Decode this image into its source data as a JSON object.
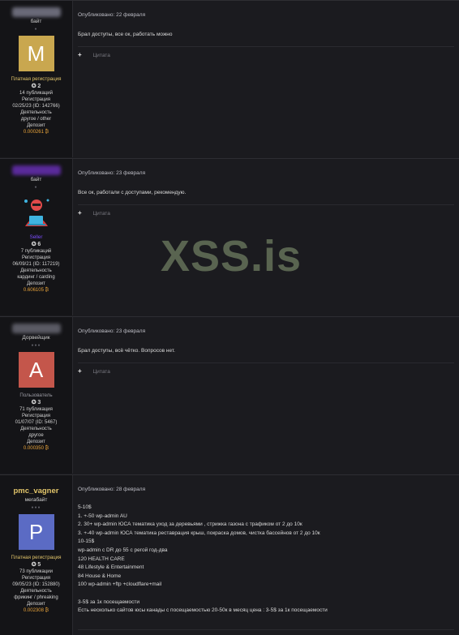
{
  "watermark": "XSS.is",
  "quote_label": "Цитата",
  "plus_glyph": "+",
  "posts": [
    {
      "rank": "байт",
      "dots": "●",
      "avatar_letter": "M",
      "avatar_color": "#c9a74f",
      "role": "Платная регистрация",
      "role_color": "#e2c56a",
      "reactions": "2",
      "publications": "14 публикаций",
      "reg_label": "Регистрация",
      "reg_value": "02/25/23 (ID: 142766)",
      "activity_label": "Деятельность",
      "activity_value": "другое / other",
      "deposit_label": "Депозит",
      "deposit_value": "0.000261 ₿",
      "posted": "Опубликовано: 22 февраля",
      "text": "Брал доступы, все ок, работать можно"
    },
    {
      "rank": "байт",
      "dots": "●",
      "avatar_letter": "",
      "avatar_color": "#141417",
      "role": "Seller",
      "role_color": "#7c4dff",
      "reactions": "6",
      "publications": "7 публикаций",
      "reg_label": "Регистрация",
      "reg_value": "06/09/21 (ID: 117219)",
      "activity_label": "Деятельность",
      "activity_value": "кардинг / carding",
      "deposit_label": "Депозит",
      "deposit_value": "0.606105 ₿",
      "posted": "Опубликовано: 23 февраля",
      "text": "Все ок, работали с доступами, рекомендую."
    },
    {
      "rank": "Дорвейщик",
      "dots": "●●●",
      "avatar_letter": "A",
      "avatar_color": "#c4564b",
      "role": "Пользователь",
      "role_color": "#9a9aa2",
      "reactions": "3",
      "publications": "71 публикация",
      "reg_label": "Регистрация",
      "reg_value": "01/07/07 (ID: 5467)",
      "activity_label": "Деятельность",
      "activity_value": "другое",
      "deposit_label": "Депозит",
      "deposit_value": "0.000350 ₿",
      "posted": "Опубликовано: 23 февраля",
      "text": "Брал доступы, всё чётко. Вопросов нет."
    },
    {
      "username": "pmc_vagner",
      "rank": "мегабайт",
      "dots": "●●●",
      "avatar_letter": "P",
      "avatar_color": "#5b6bc4",
      "role": "Платная регистрация",
      "role_color": "#e2c56a",
      "reactions": "5",
      "publications": "73 публикации",
      "reg_label": "Регистрация",
      "reg_value": "09/05/23 (ID: 152880)",
      "activity_label": "Деятельность",
      "activity_value": "фрикинг / phreaking",
      "deposit_label": "Депозит",
      "deposit_value": "0.002308 ₿",
      "posted": "Опубликовано: 28 февраля",
      "lines": [
        "5-10$",
        "1. +-50 wp-admin AU",
        "2. 30+ wp-admin ЮСА тематика уход за деревьями , стрижка газона  с трафиком от 2 до 10к",
        "3. +-40 wp-admin ЮСА тематика реставрация крыш, покраска домов, чистка бассейнов от 2 до 10к",
        "10-15$",
        "wp-admin с DR до 55 с регой год-два",
        "120 HEALTH CARE",
        "48 Lifestyle & Entertainment",
        "84 House & Home",
        "100 wp-admin +ftp +cloudflare+mail",
        "",
        "3-5$ за 1к посещаемости",
        "Есть несколько сайтов юсы канады с посещаемостью 20-50к в месяц  цена : 3-5$ за 1к посещаемости"
      ]
    }
  ]
}
